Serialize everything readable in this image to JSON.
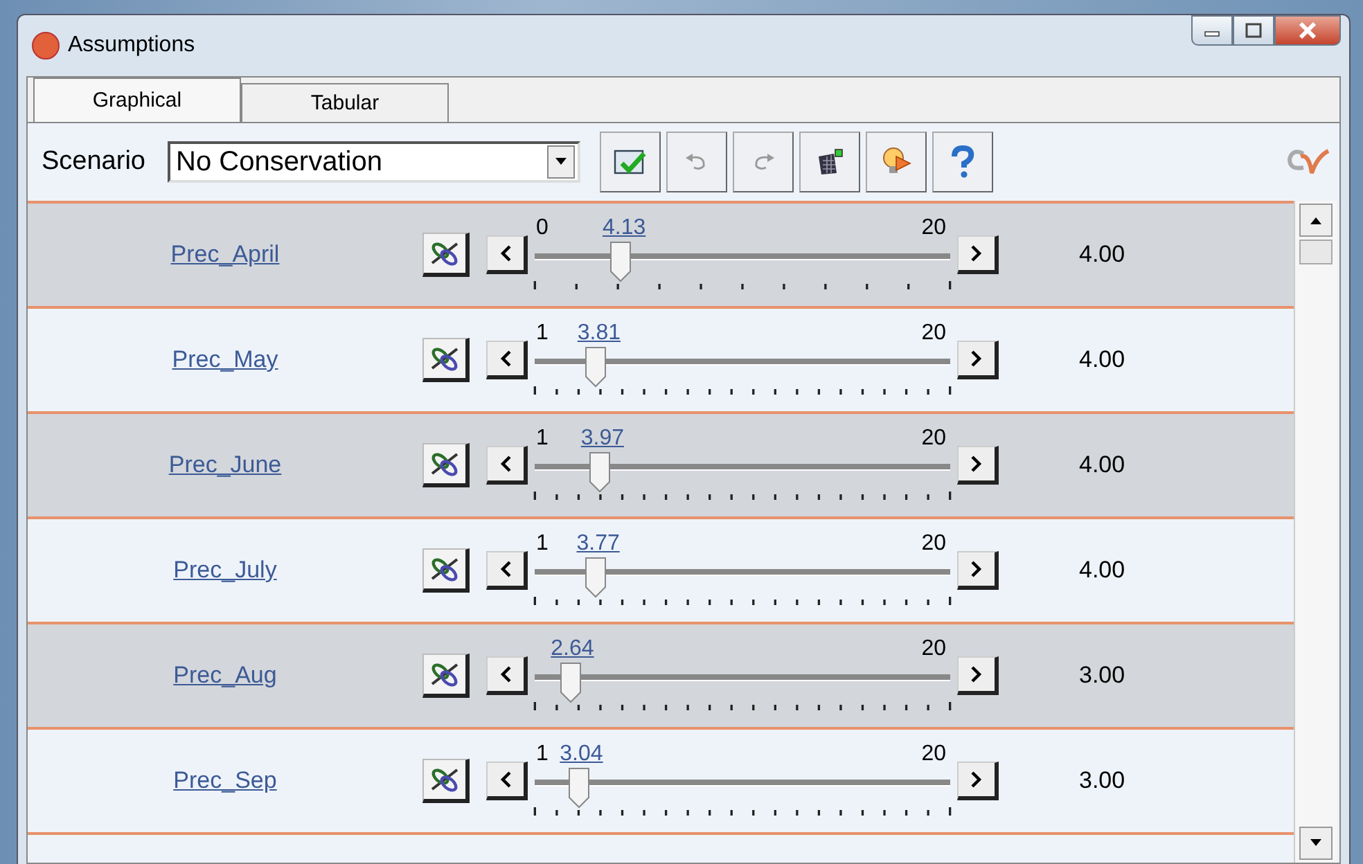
{
  "window": {
    "title": "Assumptions"
  },
  "tabs": [
    {
      "label": "Graphical",
      "selected": true
    },
    {
      "label": "Tabular",
      "selected": false
    }
  ],
  "toolbar": {
    "scenario_label": "Scenario",
    "scenario": "No Conservation"
  },
  "rows": [
    {
      "name": "Prec_April",
      "min": "0",
      "max": "20",
      "current": "4.13",
      "level": 0.2065,
      "value": "4.00"
    },
    {
      "name": "Prec_May",
      "min": "1",
      "max": "20",
      "current": "3.81",
      "level": 0.148,
      "value": "4.00"
    },
    {
      "name": "Prec_June",
      "min": "1",
      "max": "20",
      "current": "3.97",
      "level": 0.156,
      "value": "4.00"
    },
    {
      "name": "Prec_July",
      "min": "1",
      "max": "20",
      "current": "3.77",
      "level": 0.146,
      "value": "4.00"
    },
    {
      "name": "Prec_Aug",
      "max": "20",
      "current": "2.64",
      "level": 0.086,
      "value": "3.00"
    },
    {
      "name": "Prec_Sep",
      "min": "1",
      "max": "20",
      "current": "3.04",
      "level": 0.107,
      "value": "3.00"
    }
  ]
}
